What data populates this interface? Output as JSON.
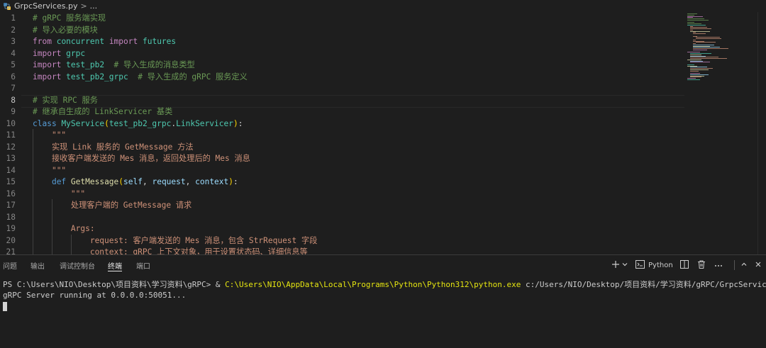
{
  "breadcrumb": {
    "file": "GrpcServices.py",
    "separator": ">",
    "more": "..."
  },
  "editor": {
    "current_line": 8,
    "lines": [
      [
        [
          "cm",
          "# gRPC 服务端实现"
        ]
      ],
      [
        [
          "cm",
          "# 导入必要的模块"
        ]
      ],
      [
        [
          "kw",
          "from"
        ],
        [
          "",
          " "
        ],
        [
          "md",
          "concurrent"
        ],
        [
          "",
          " "
        ],
        [
          "kw",
          "import"
        ],
        [
          "",
          " "
        ],
        [
          "md",
          "futures"
        ]
      ],
      [
        [
          "kw",
          "import"
        ],
        [
          "",
          " "
        ],
        [
          "md",
          "grpc"
        ]
      ],
      [
        [
          "kw",
          "import"
        ],
        [
          "",
          " "
        ],
        [
          "md",
          "test_pb2"
        ],
        [
          "",
          "  "
        ],
        [
          "cm",
          "# 导入生成的消息类型"
        ]
      ],
      [
        [
          "kw",
          "import"
        ],
        [
          "",
          " "
        ],
        [
          "md",
          "test_pb2_grpc"
        ],
        [
          "",
          "  "
        ],
        [
          "cm",
          "# 导入生成的 gRPC 服务定义"
        ]
      ],
      [],
      [
        [
          "cm",
          "# 实现 RPC 服务"
        ]
      ],
      [
        [
          "cm",
          "# 继承自生成的 LinkServicer 基类"
        ]
      ],
      [
        [
          "kw2",
          "class"
        ],
        [
          "",
          " "
        ],
        [
          "md",
          "MyService"
        ],
        [
          "br1",
          "("
        ],
        [
          "md",
          "test_pb2_grpc"
        ],
        [
          "",
          "."
        ],
        [
          "md",
          "LinkServicer"
        ],
        [
          "br1",
          ")"
        ],
        [
          "",
          ":"
        ]
      ],
      [
        [
          "",
          "    "
        ],
        [
          "str",
          "\"\"\""
        ]
      ],
      [
        [
          "",
          "    "
        ],
        [
          "str",
          "实现 Link 服务的 GetMessage 方法"
        ]
      ],
      [
        [
          "",
          "    "
        ],
        [
          "str",
          "接收客户端发送的 Mes 消息，返回处理后的 Mes 消息"
        ]
      ],
      [
        [
          "",
          "    "
        ],
        [
          "str",
          "\"\"\""
        ]
      ],
      [
        [
          "",
          "    "
        ],
        [
          "kw2",
          "def"
        ],
        [
          "",
          " "
        ],
        [
          "fn",
          "GetMessage"
        ],
        [
          "br1",
          "("
        ],
        [
          "par",
          "self"
        ],
        [
          "",
          ", "
        ],
        [
          "par",
          "request"
        ],
        [
          "",
          ", "
        ],
        [
          "par",
          "context"
        ],
        [
          "br1",
          ")"
        ],
        [
          "",
          ":"
        ]
      ],
      [
        [
          "",
          "        "
        ],
        [
          "str",
          "\"\"\""
        ]
      ],
      [
        [
          "",
          "        "
        ],
        [
          "str",
          "处理客户端的 GetMessage 请求"
        ]
      ],
      [],
      [
        [
          "",
          "        "
        ],
        [
          "str",
          "Args:"
        ]
      ],
      [
        [
          "",
          "            "
        ],
        [
          "str",
          "request: 客户端发送的 Mes 消息，包含 StrRequest 字段"
        ]
      ],
      [
        [
          "",
          "            "
        ],
        [
          "str",
          "context: gRPC 上下文对象，用于设置状态码、详细信息等"
        ]
      ]
    ]
  },
  "panel": {
    "tabs": [
      "问题",
      "输出",
      "调试控制台",
      "终端",
      "端口"
    ],
    "active_tab": "终端",
    "shell_label": "Python",
    "terminal": {
      "prompt": "PS C:\\Users\\NIO\\Desktop\\项目资料\\学习资料\\gRPC> & ",
      "exe": "C:\\Users\\NIO\\AppData\\Local\\Programs\\Python\\Python312\\python.exe",
      "args": " c:/Users/NIO/Desktop/项目资料/学习资料/gRPC/GrpcServices.py",
      "output": "gRPC Server running at 0.0.0.0:50051..."
    }
  },
  "icons": {
    "file": "python-file-icon",
    "add": "plus-icon",
    "dropdown": "chevron-down-icon",
    "shell": "terminal-icon",
    "split": "split-icon",
    "trash": "trash-icon",
    "more": "ellipsis-icon",
    "maximize": "chevron-up-icon",
    "close": "close-icon"
  },
  "colors": {
    "background": "#1e1e1e",
    "comment": "#6a9955",
    "keyword": "#c586c0",
    "storage": "#569cd6",
    "class": "#4ec9b0",
    "function": "#dcdcaa",
    "string": "#ce9178",
    "parameter": "#9cdcfe",
    "terminal_path": "#e5e510"
  }
}
